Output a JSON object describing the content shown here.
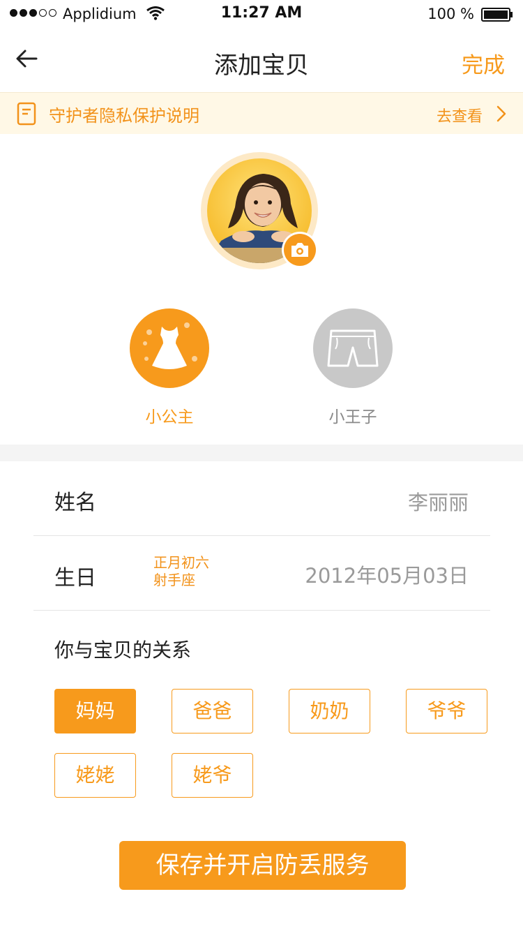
{
  "status_bar": {
    "carrier": "Applidium",
    "time": "11:27 AM",
    "battery": "100 %",
    "icons": [
      "signal-dots-icon",
      "wifi-icon",
      "battery-icon"
    ]
  },
  "nav": {
    "title": "添加宝贝",
    "done_label": "完成",
    "back_icon": "arrow-left-icon"
  },
  "privacy_banner": {
    "text": "守护者隐私保护说明",
    "link": "去查看",
    "icons": [
      "document-icon",
      "chevron-right-icon"
    ]
  },
  "avatar": {
    "camera_icon": "camera-icon"
  },
  "gender": {
    "options": [
      {
        "label": "小公主",
        "icon": "dress-icon",
        "selected": true
      },
      {
        "label": "小王子",
        "icon": "shorts-icon",
        "selected": false
      }
    ]
  },
  "form": {
    "name_label": "姓名",
    "name_value": "李丽丽",
    "birthday_label": "生日",
    "lunar_date": "正月初六",
    "zodiac": "射手座",
    "birthday_value": "2012年05月03日"
  },
  "relation": {
    "title": "你与宝贝的关系",
    "options": [
      {
        "label": "妈妈",
        "selected": true
      },
      {
        "label": "爸爸",
        "selected": false
      },
      {
        "label": "奶奶",
        "selected": false
      },
      {
        "label": "爷爷",
        "selected": false
      },
      {
        "label": "姥姥",
        "selected": false
      },
      {
        "label": "姥爷",
        "selected": false
      }
    ]
  },
  "submit_label": "保存并开启防丢服务",
  "colors": {
    "accent": "#f79a1c",
    "banner_bg": "#fff8e6",
    "inactive_gray": "#c8c8c8",
    "gap_gray": "#f4f4f4"
  }
}
